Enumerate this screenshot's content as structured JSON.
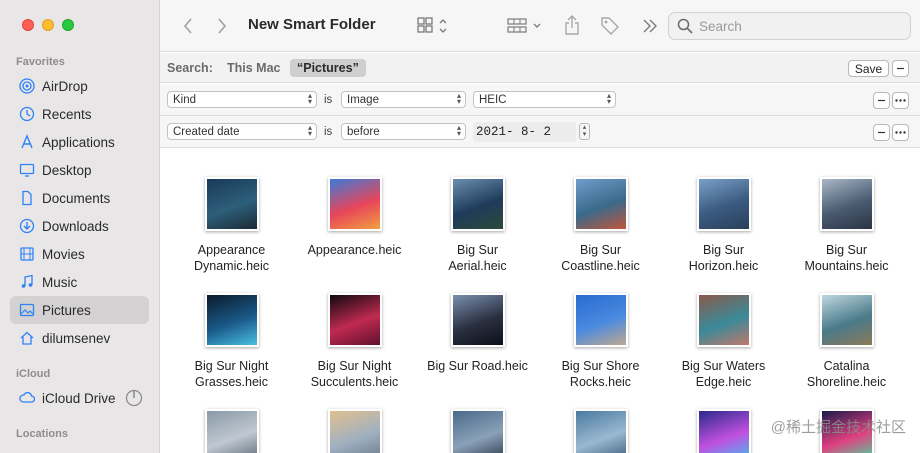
{
  "window": {
    "title": "New Smart Folder"
  },
  "colors": {
    "close": "#ff5f57",
    "minimize": "#febc2e",
    "zoom": "#28c840",
    "accent": "#2f82f6"
  },
  "sidebar": {
    "favorites_label": "Favorites",
    "items": [
      {
        "label": "AirDrop",
        "icon": "airdrop-icon"
      },
      {
        "label": "Recents",
        "icon": "clock-icon"
      },
      {
        "label": "Applications",
        "icon": "applications-icon"
      },
      {
        "label": "Desktop",
        "icon": "desktop-icon"
      },
      {
        "label": "Documents",
        "icon": "document-icon"
      },
      {
        "label": "Downloads",
        "icon": "download-icon"
      },
      {
        "label": "Movies",
        "icon": "film-icon"
      },
      {
        "label": "Music",
        "icon": "music-note-icon"
      },
      {
        "label": "Pictures",
        "icon": "photo-icon",
        "selected": true
      },
      {
        "label": "dilumsenev",
        "icon": "home-icon"
      }
    ],
    "icloud_label": "iCloud",
    "icloud_items": [
      {
        "label": "iCloud Drive",
        "icon": "cloud-icon"
      }
    ],
    "locations_label": "Locations"
  },
  "toolbar": {
    "search_placeholder": "Search"
  },
  "scope": {
    "label": "Search:",
    "option_this_mac": "This Mac",
    "option_pictures": "“Pictures”",
    "save_label": "Save",
    "minus_label": "—"
  },
  "criteria": [
    {
      "attribute": "Kind",
      "operator_text": "is",
      "value_select": "Image",
      "subvalue": "HEIC"
    },
    {
      "attribute": "Created date",
      "operator_text": "is",
      "value_select": "before",
      "date": "2021- 8- 2"
    }
  ],
  "files": [
    {
      "name": "Appearance Dynamic.heic",
      "line1": "Appearance",
      "line2": "Dynamic.heic",
      "colors": [
        "#1a3a5a",
        "#2d5f7a",
        "#1c2a35"
      ]
    },
    {
      "name": "Appearance.heic",
      "line1": "Appearance.heic",
      "line2": "",
      "colors": [
        "#3b7bd8",
        "#e8455a",
        "#f0a040"
      ]
    },
    {
      "name": "Big Sur Aerial.heic",
      "line1": "Big Sur",
      "line2": "Aerial.heic",
      "colors": [
        "#6b8fb0",
        "#1f3b5a",
        "#2a4a3a"
      ]
    },
    {
      "name": "Big Sur Coastline.heic",
      "line1": "Big Sur",
      "line2": "Coastline.heic",
      "colors": [
        "#6f9ccc",
        "#3a6a8a",
        "#c2553a"
      ]
    },
    {
      "name": "Big Sur Horizon.heic",
      "line1": "Big Sur",
      "line2": "Horizon.heic",
      "colors": [
        "#7aa0c8",
        "#3a5a80",
        "#2a4058"
      ]
    },
    {
      "name": "Big Sur Mountains.heic",
      "line1": "Big Sur",
      "line2": "Mountains.heic",
      "colors": [
        "#a8b8c8",
        "#4a5a70",
        "#2a3545"
      ]
    },
    {
      "name": "Big Sur Night Grasses.heic",
      "line1": "Big Sur Night",
      "line2": "Grasses.heic",
      "colors": [
        "#0a1a2a",
        "#1a5a8a",
        "#4ac0e0"
      ]
    },
    {
      "name": "Big Sur Night Succulents.heic",
      "line1": "Big Sur Night",
      "line2": "Succulents.heic",
      "colors": [
        "#100810",
        "#c02a50",
        "#601030"
      ]
    },
    {
      "name": "Big Sur Road.heic",
      "line1": "Big Sur Road.heic",
      "line2": "",
      "colors": [
        "#7a90b0",
        "#2a3040",
        "#0a1018"
      ]
    },
    {
      "name": "Big Sur Shore Rocks.heic",
      "line1": "Big Sur Shore",
      "line2": "Rocks.heic",
      "colors": [
        "#2a6ad0",
        "#4a8ae0",
        "#c0a890"
      ]
    },
    {
      "name": "Big Sur Waters Edge.heic",
      "line1": "Big Sur Waters",
      "line2": "Edge.heic",
      "colors": [
        "#8a5a4a",
        "#3a8a9a",
        "#c0786a"
      ]
    },
    {
      "name": "Catalina Shoreline.heic",
      "line1": "Catalina",
      "line2": "Shoreline.heic",
      "colors": [
        "#c0d8e0",
        "#4a7a8a",
        "#8a7a5a"
      ]
    },
    {
      "name": "",
      "line1": "",
      "line2": "",
      "colors": [
        "#8a9aa8",
        "#c0c8d0",
        "#5a6a78"
      ]
    },
    {
      "name": "",
      "line1": "",
      "line2": "",
      "colors": [
        "#e0c090",
        "#a0b0c0",
        "#6a7a8a"
      ]
    },
    {
      "name": "",
      "line1": "",
      "line2": "",
      "colors": [
        "#4a6a8a",
        "#8aa0b8",
        "#2a3a4a"
      ]
    },
    {
      "name": "",
      "line1": "",
      "line2": "",
      "colors": [
        "#4a7aa0",
        "#9ab8d0",
        "#3a5a78"
      ]
    },
    {
      "name": "",
      "line1": "",
      "line2": "",
      "colors": [
        "#2a2a8a",
        "#c050e0",
        "#40c0f0"
      ]
    },
    {
      "name": "",
      "line1": "",
      "line2": "",
      "colors": [
        "#1a1a4a",
        "#e04080",
        "#40e0a0"
      ]
    }
  ],
  "watermark": "@稀土掘金技术社区"
}
